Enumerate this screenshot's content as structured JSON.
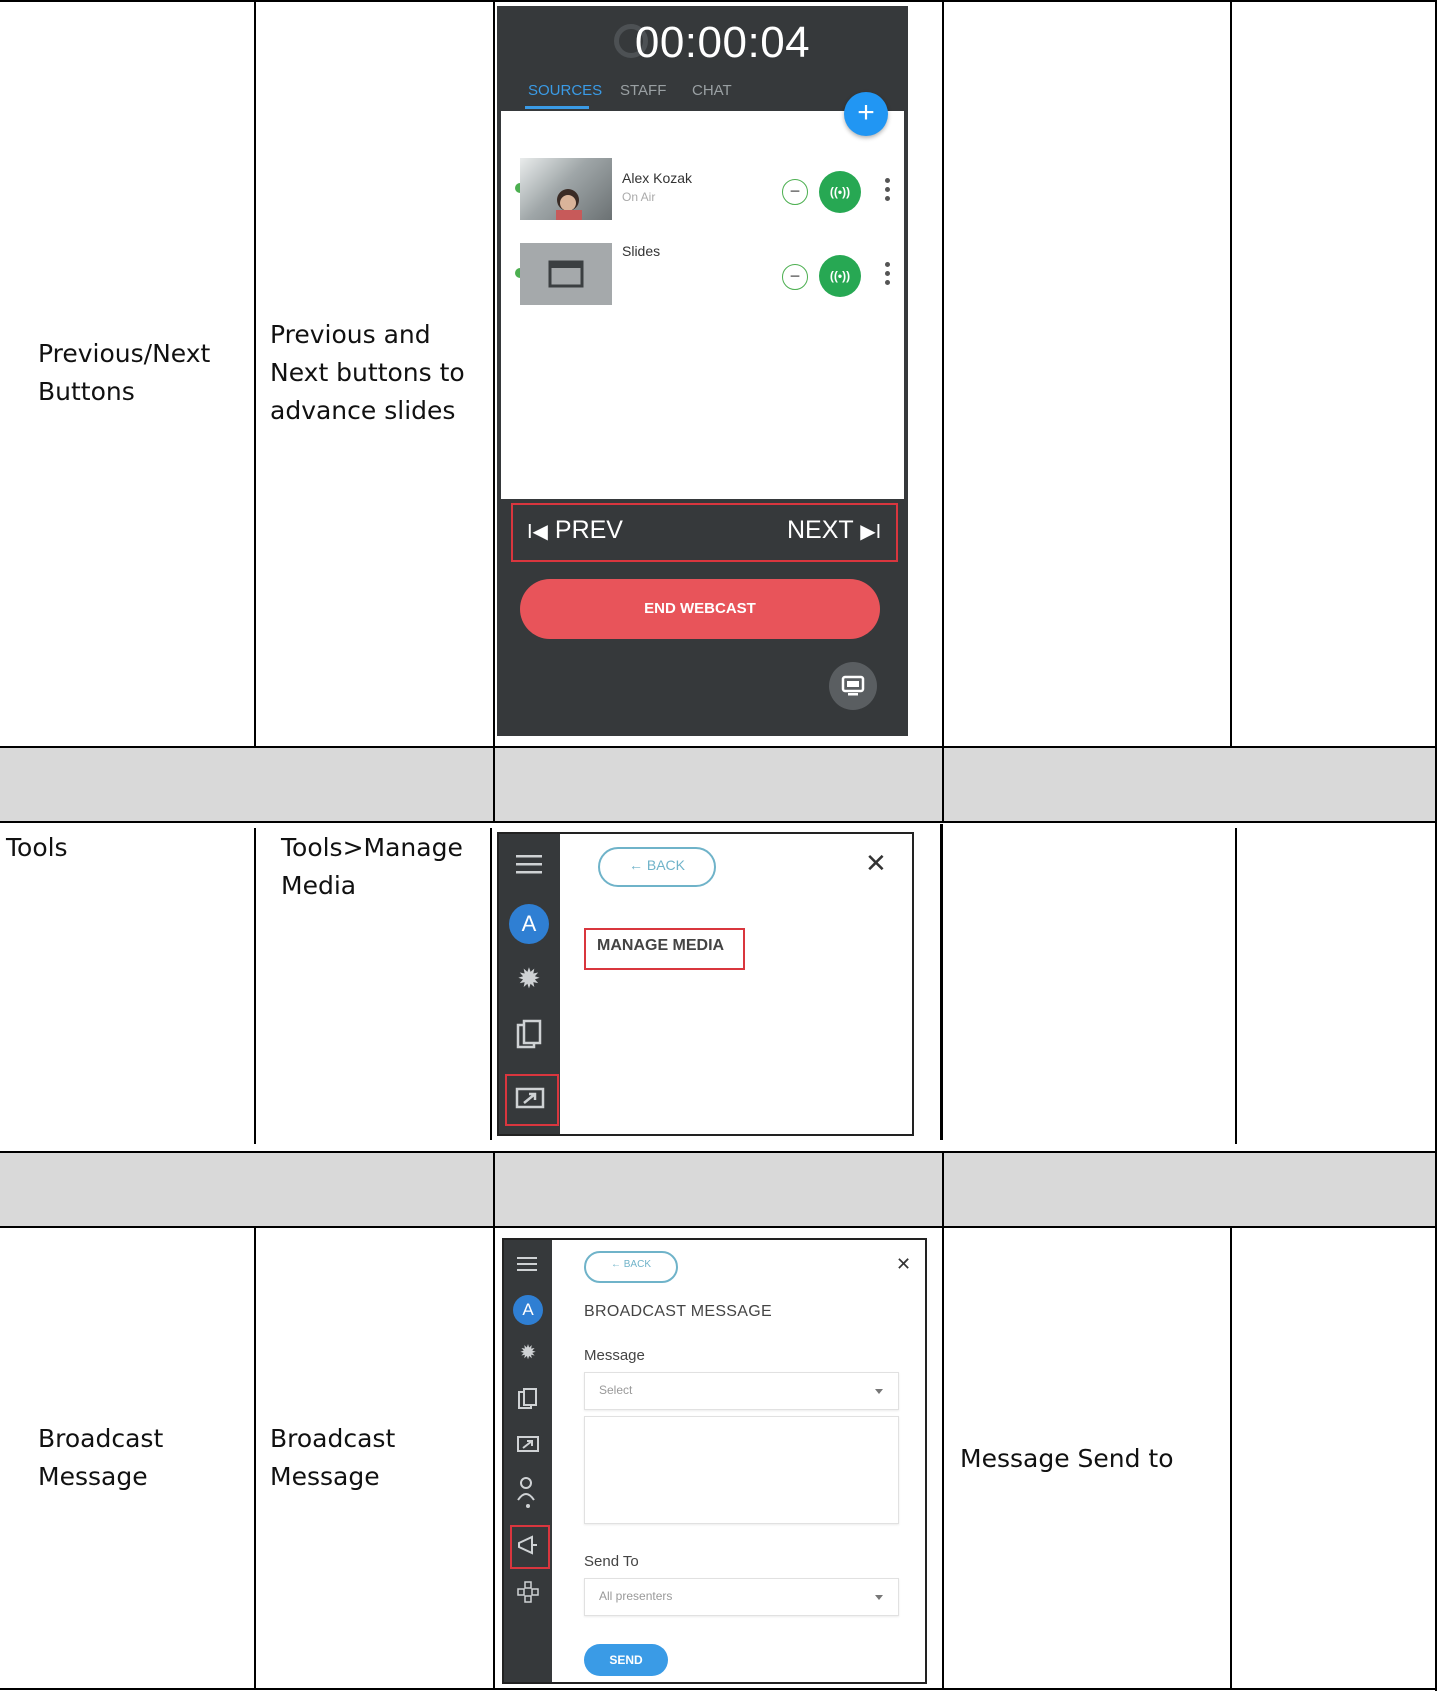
{
  "rows": {
    "prev_next": {
      "name": "Previous/Next Buttons",
      "description": "Previous and Next buttons to advance slides"
    },
    "tools": {
      "name": "Tools",
      "description": "Tools>Manage Media"
    },
    "broadcast": {
      "name": "Broadcast Message",
      "description": "Broadcast Message",
      "extra": "Message Send to"
    }
  },
  "phone": {
    "timer": "00:00:04",
    "tabs": [
      "SOURCES",
      "STAFF",
      "CHAT"
    ],
    "add_label": "+",
    "sources": [
      {
        "name": "Alex Kozak",
        "status": "On Air"
      },
      {
        "name": "Slides",
        "status": ""
      }
    ],
    "onair_label": "((•))",
    "minus_label": "−",
    "prev_label": "PREV",
    "next_label": "NEXT",
    "prev_icon": "I◀",
    "next_icon": "▶I",
    "end_label": "END WEBCAST"
  },
  "manage_media": {
    "back_label": "← BACK",
    "close_label": "✕",
    "title": "MANAGE MEDIA",
    "avatar": "A",
    "icons": [
      "menu-icon",
      "gear-icon",
      "clipboard-icon",
      "media-icon"
    ]
  },
  "broadcast_panel": {
    "back_label": "← BACK",
    "close_label": "✕",
    "title": "BROADCAST MESSAGE",
    "message_label": "Message",
    "select_placeholder": "Select",
    "send_to_label": "Send To",
    "send_to_value": "All presenters",
    "send_label": "SEND",
    "avatar": "A",
    "icons": [
      "menu-icon",
      "gear-icon",
      "clipboard-icon",
      "media-icon",
      "presenter-icon",
      "megaphone-icon",
      "layout-icon"
    ]
  },
  "colors": {
    "accent_blue": "#3a9be6",
    "on_air_green": "#27a853",
    "end_red": "#e8545a",
    "highlight_red": "#d9363e",
    "dark_panel": "#36393b",
    "shade_gray": "#d9d9d9"
  }
}
